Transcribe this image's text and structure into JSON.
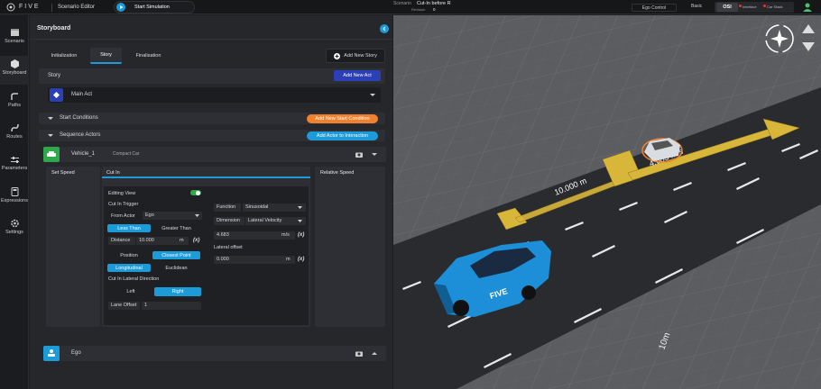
{
  "app": {
    "brand": "FIVE",
    "title": "Scenario Editor",
    "start_sim": "Start Simulation"
  },
  "scenario": {
    "label": "Scenario",
    "name": "Cut-In before R",
    "revision_label": "Revision",
    "revision": "0"
  },
  "top_right": {
    "ego_control": "Ego Control",
    "basic": "Basic",
    "osi": "OSI",
    "interface": "Interface",
    "car_stack": "Car Stack"
  },
  "nav": [
    {
      "label": "Scenario"
    },
    {
      "label": "Storyboard"
    },
    {
      "label": "Paths"
    },
    {
      "label": "Routes"
    },
    {
      "label": "Parameters"
    },
    {
      "label": "Expressions"
    },
    {
      "label": "Settings"
    }
  ],
  "storyboard": {
    "title": "Storyboard",
    "tabs": [
      "Initialization",
      "Story",
      "Finalisation"
    ],
    "add_story": "Add New Story",
    "story_label": "Story",
    "add_act": "Add New Act",
    "act_name": "Main Act",
    "start_conditions": "Start Conditions",
    "add_start_condition": "Add New Start Condition",
    "sequence_actors": "Sequence Actors",
    "add_actor": "Add Actor to Interaction",
    "actor": {
      "name": "Vehicle_1",
      "type": "Compact Car"
    },
    "ego": "Ego"
  },
  "columns": {
    "set_speed": "Set Speed",
    "cut_in": "Cut In",
    "relative_speed": "Relative Speed"
  },
  "cutin": {
    "editing_view": "Editing View",
    "trigger": "Cut In Trigger",
    "from_actor_label": "From Actor",
    "from_actor": "Ego",
    "less_than": "Less Than",
    "greater_than": "Greater Than",
    "distance_label": "Distance",
    "distance": "10.000",
    "distance_unit": "m",
    "fx": "(x)",
    "position": "Position",
    "closest_point": "Closest Point",
    "longitudinal": "Longitudinal",
    "euclidean": "Euclidean",
    "lateral_dir": "Cut In Lateral Direction",
    "left": "Left",
    "right": "Right",
    "lane_offset_label": "Lane Offset",
    "lane_offset": "1",
    "function_label": "Function",
    "function": "Sinusoidal",
    "dimension_label": "Dimension",
    "dimension": "Lateral Velocity",
    "velocity": "4.683",
    "velocity_unit": "m/s",
    "lateral_offset_label": "Lateral offset",
    "lateral_offset": "0.000",
    "lateral_offset_unit": "m"
  },
  "viewport": {
    "distance_label": "10.000 m",
    "speed_label": "4.683 m/s",
    "grid_label": "10m",
    "car_text": "FIVE"
  },
  "colors": {
    "accent": "#1d9bd8",
    "orange": "#f0822f",
    "add_act": "#2b3fb6",
    "ego_green": "#2ea84a",
    "road": "#2a2b2e",
    "path_yellow": "#d8b63a"
  }
}
